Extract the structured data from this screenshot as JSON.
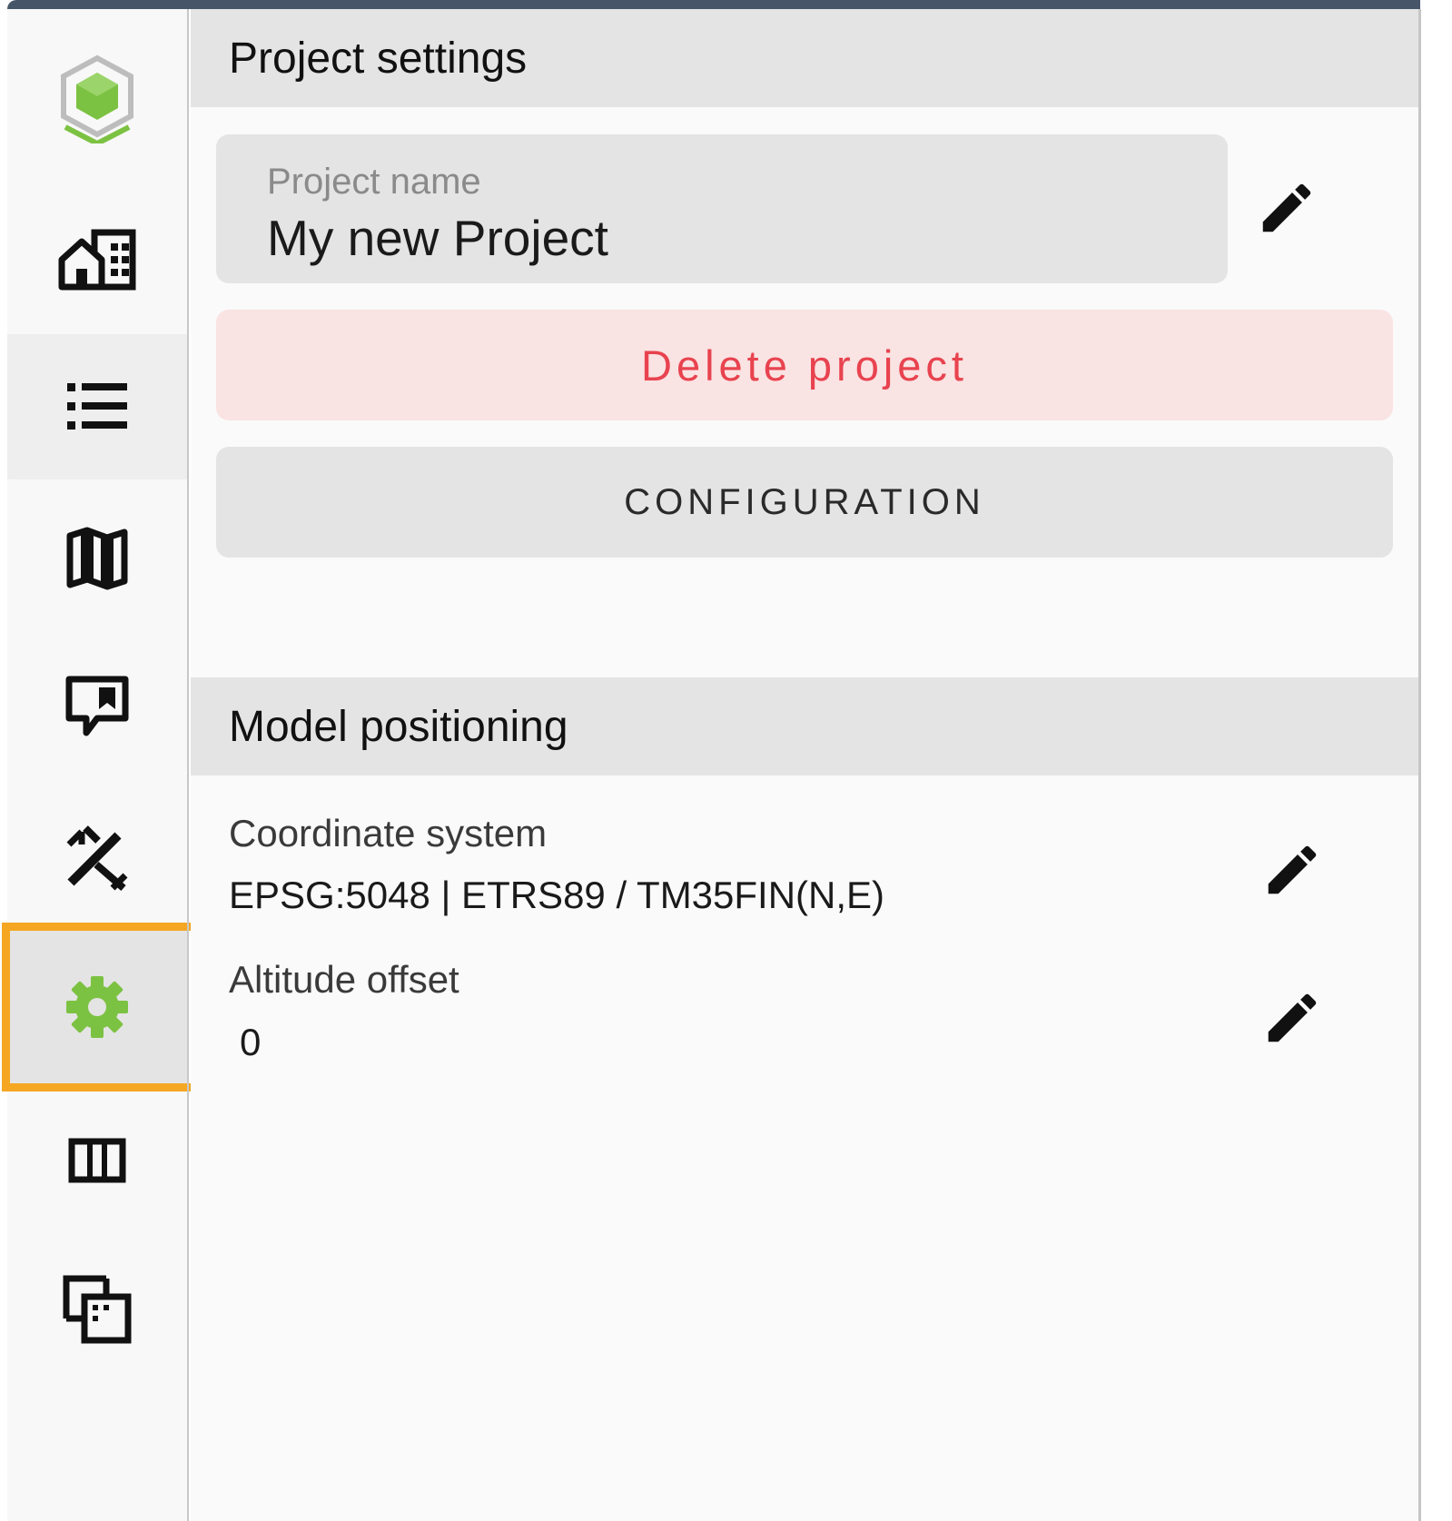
{
  "sidebar": {
    "items": [
      {
        "icon": "logo-cube-icon"
      },
      {
        "icon": "buildings-icon"
      },
      {
        "icon": "list-icon"
      },
      {
        "icon": "map-icon"
      },
      {
        "icon": "comment-flag-icon"
      },
      {
        "icon": "measure-tools-icon"
      },
      {
        "icon": "gear-icon"
      },
      {
        "icon": "columns-icon"
      },
      {
        "icon": "select-region-icon"
      }
    ],
    "selected": "gear-icon",
    "accent_color": "#7cc242",
    "highlight_color": "#f5a623"
  },
  "project_settings": {
    "title": "Project settings",
    "name_label": "Project name",
    "name_value": "My new Project",
    "delete_label": "Delete project",
    "configuration_label": "CONFIGURATION"
  },
  "model_positioning": {
    "title": "Model positioning",
    "coordinate_label": "Coordinate system",
    "coordinate_value": "EPSG:5048 | ETRS89 / TM35FIN(N,E)",
    "altitude_label": "Altitude offset",
    "altitude_value": "0"
  }
}
